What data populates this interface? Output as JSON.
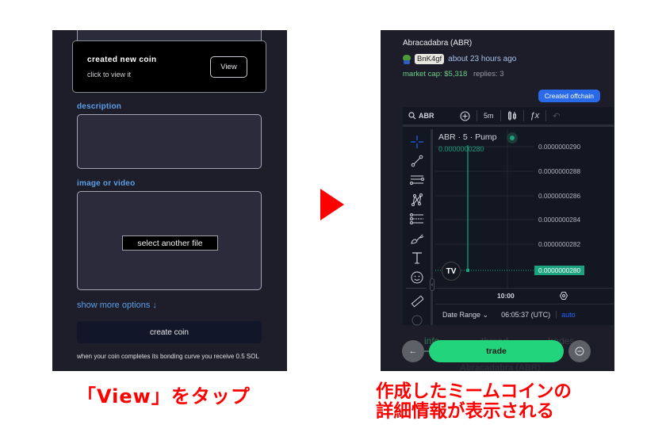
{
  "left_screen": {
    "toast": {
      "title": "created new coin",
      "subtitle": "click to view it",
      "view_button": "View"
    },
    "description": {
      "label": "description",
      "value": ""
    },
    "media": {
      "label": "image or video",
      "select_button": "select another file"
    },
    "show_more_options": "show more options ↓",
    "create_button": "create coin",
    "bonding_note": "when your coin completes its bonding curve you receive 0.5 SOL"
  },
  "right_screen": {
    "coin_title": "Abracadabra (ABR)",
    "creator_badge": "BnK4gf",
    "created_time": "about 23 hours ago",
    "market_cap": "market cap: $5,318",
    "replies": "replies: 3",
    "offchain_badge": "Created offchain",
    "chart": {
      "symbol": "ABR",
      "interval": "5m",
      "legend_title": "ABR · 5 · Pump",
      "legend_value": "0.0000000280",
      "price_levels": [
        "0.0000000290",
        "0.0000000288",
        "0.0000000286",
        "0.0000000284",
        "0.0000000282"
      ],
      "last_price": "0.0000000280",
      "time_label": "10:00",
      "date_range": "Date Range ⌄",
      "utc_time": "06:05:37 (UTC)",
      "auto_label": "auto",
      "logo": "TV"
    },
    "tabs": [
      "info",
      "thread",
      "trades"
    ],
    "ghost_title": "Abracadabra (ABR)",
    "trade_button": "trade",
    "back_icon": "←"
  },
  "captions": {
    "left": "「View」をタップ",
    "right_line1": "作成したミームコインの",
    "right_line2": "詳細情報が表示される"
  },
  "colors": {
    "accent_blue": "#5c9ee6",
    "trade_green": "#22d47b",
    "chart_green": "#1ba37f",
    "caption_red": "#ff0000"
  }
}
